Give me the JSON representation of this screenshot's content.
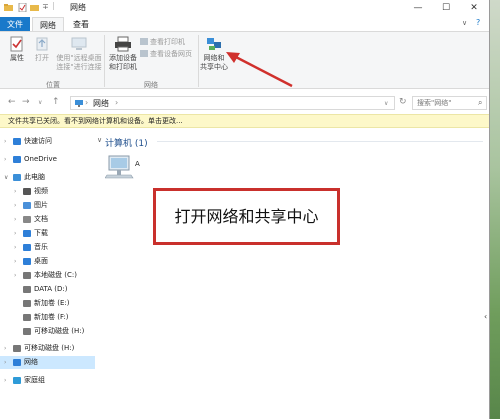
{
  "window": {
    "title": "网络",
    "controls": {
      "minimize": "—",
      "maximize": "☐",
      "close": "✕"
    }
  },
  "tabs": {
    "file": "文件",
    "computer": "网络",
    "view": "查看"
  },
  "ribbon": {
    "properties": "属性",
    "open": "打开",
    "remote_desktop_line1": "使用\"远程桌面",
    "remote_desktop_line2": "连接\"进行连接",
    "group_location": "位置",
    "add_device_line1": "添加设备",
    "add_device_line2": "和打印机",
    "view_printers": "查看打印机",
    "view_webpage": "查看设备网页",
    "group_network": "网络",
    "network_center_line1": "网络和",
    "network_center_line2": "共享中心"
  },
  "address": {
    "back": "←",
    "forward": "→",
    "recent": "∨",
    "up": "↑",
    "path": "网络",
    "separator": "›",
    "refresh": "↻",
    "search_placeholder": "搜索\"网络\""
  },
  "infobar": {
    "text": "文件共享已关闭。看不到网络计算机和设备。单击更改..."
  },
  "nav": [
    {
      "label": "快速访问",
      "icon": "star-icon",
      "color": "#2e7fd8"
    },
    {
      "label": "OneDrive",
      "icon": "cloud-icon",
      "color": "#2e7fd8"
    },
    {
      "label": "此电脑",
      "icon": "computer-icon",
      "color": "#3b8fd8"
    },
    {
      "label": "视频",
      "icon": "video-icon",
      "color": "#555"
    },
    {
      "label": "图片",
      "icon": "picture-icon",
      "color": "#4a90d9"
    },
    {
      "label": "文档",
      "icon": "document-icon",
      "color": "#888"
    },
    {
      "label": "下载",
      "icon": "download-icon",
      "color": "#2e7fd8"
    },
    {
      "label": "音乐",
      "icon": "music-icon",
      "color": "#2e7fd8"
    },
    {
      "label": "桌面",
      "icon": "desktop-icon",
      "color": "#2e7fd8"
    },
    {
      "label": "本地磁盘 (C:)",
      "icon": "drive-icon",
      "color": "#777"
    },
    {
      "label": "DATA (D:)",
      "icon": "drive-icon",
      "color": "#777"
    },
    {
      "label": "新加卷 (E:)",
      "icon": "drive-icon",
      "color": "#777"
    },
    {
      "label": "新加卷 (F:)",
      "icon": "drive-icon",
      "color": "#777"
    },
    {
      "label": "可移动磁盘 (H:)",
      "icon": "usb-drive-icon",
      "color": "#777"
    },
    {
      "label": "可移动磁盘 (H:)",
      "icon": "usb-drive-icon",
      "color": "#777"
    },
    {
      "label": "网络",
      "icon": "network-icon",
      "color": "#2e7fd8"
    },
    {
      "label": "家庭组",
      "icon": "homegroup-icon",
      "color": "#2e9bd8"
    }
  ],
  "content": {
    "group_header": "计算机 (1)",
    "item_label": "A"
  },
  "annotation": {
    "text": "打开网络和共享中心",
    "color": "#c9302c"
  }
}
